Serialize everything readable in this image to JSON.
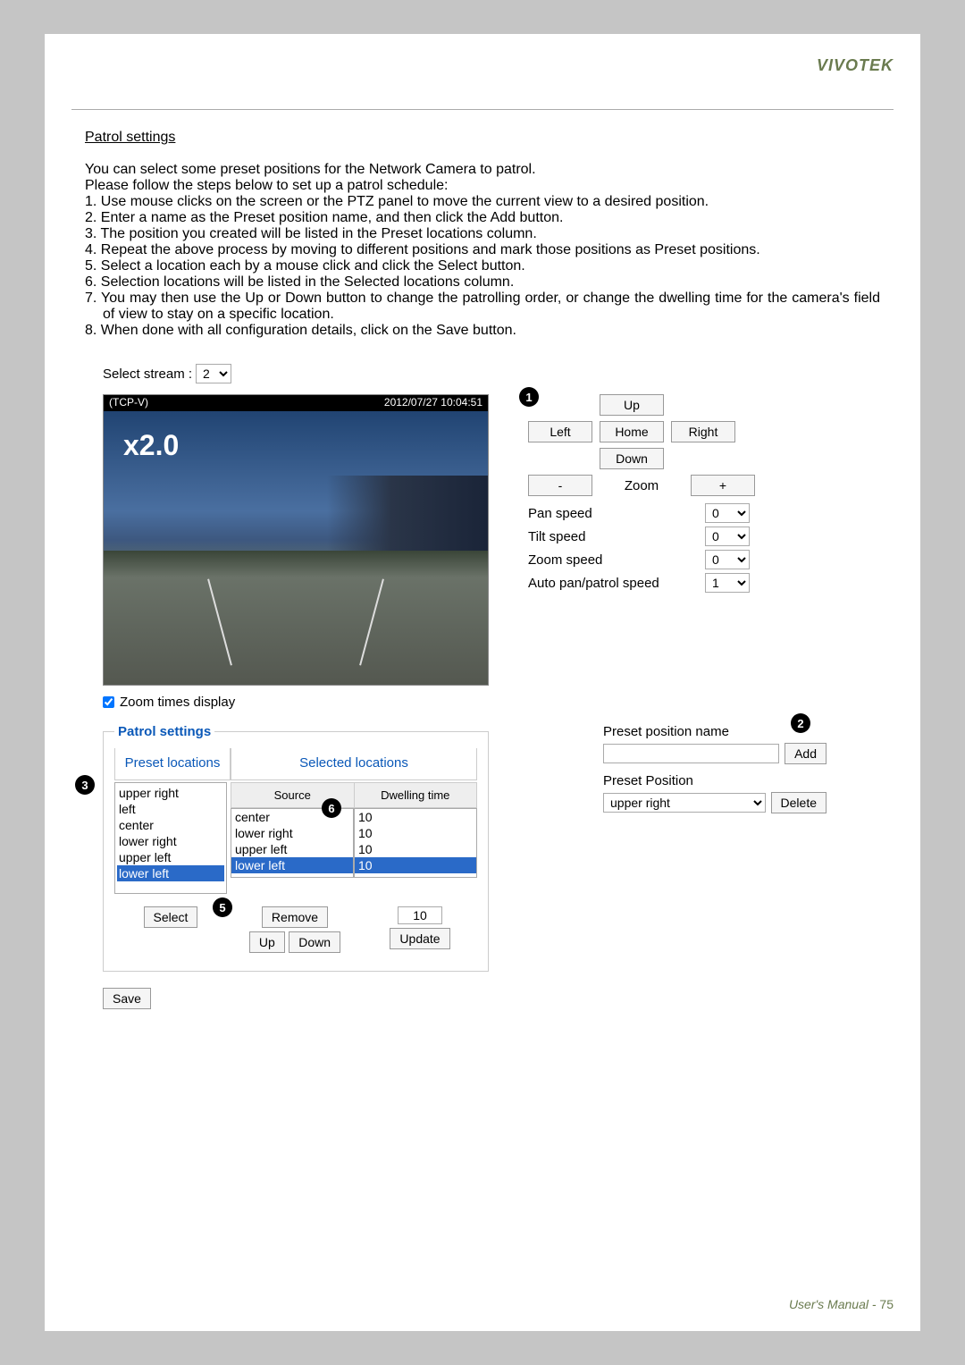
{
  "brand": "VIVOTEK",
  "section_title": "Patrol settings",
  "intro1": "You can select some preset positions for the Network Camera to patrol.",
  "intro2": "Please follow the steps below to set up a patrol schedule:",
  "steps": {
    "s1": "1. Use mouse clicks on the screen or the PTZ panel to move the current view to a desired position.",
    "s2": "2. Enter a name as the Preset position name, and then click the Add button.",
    "s3": "3. The position you created will be listed in the Preset locations column.",
    "s4": "4. Repeat the above process by moving to different positions and mark those positions as Preset positions.",
    "s5": "5. Select a location each by a mouse click and click the Select button.",
    "s6": "6. Selection locations will be listed in the Selected locations column.",
    "s7": "7. You may then use the Up or Down button to change the patrolling order, or change the dwelling time for the camera's field of view to stay on a specific location.",
    "s8": "8. When done with all configuration details, click on the Save button."
  },
  "stream": {
    "label": "Select stream :",
    "value": "2"
  },
  "video": {
    "protocol": "(TCP-V)",
    "timestamp": "2012/07/27 10:04:51",
    "zoom": "x2.0"
  },
  "ptz": {
    "up": "Up",
    "left": "Left",
    "home": "Home",
    "right": "Right",
    "down": "Down",
    "minus": "-",
    "zoom_label": "Zoom",
    "plus": "+",
    "pan_speed": "Pan speed",
    "pan_val": "0",
    "tilt_speed": "Tilt speed",
    "tilt_val": "0",
    "zoom_speed": "Zoom speed",
    "zoom_val": "0",
    "auto_speed": "Auto pan/patrol speed",
    "auto_val": "1"
  },
  "zoom_display_label": "Zoom times display",
  "patrol": {
    "legend": "Patrol settings",
    "preset_header": "Preset locations",
    "selected_header": "Selected locations",
    "source_header": "Source",
    "dwell_header": "Dwelling time",
    "preset_items": {
      "i0": "upper right",
      "i1": "left",
      "i2": "center",
      "i3": "lower right",
      "i4": "upper left",
      "i5": "lower left"
    },
    "source_items": {
      "i0": "center",
      "i1": "lower right",
      "i2": "upper left",
      "i3": "lower left"
    },
    "dwell_items": {
      "i0": "10",
      "i1": "10",
      "i2": "10",
      "i3": "10"
    },
    "select_btn": "Select",
    "remove_btn": "Remove",
    "up_btn": "Up",
    "down_btn": "Down",
    "dwell_input": "10",
    "update_btn": "Update"
  },
  "preset_form": {
    "name_label": "Preset position name",
    "add_btn": "Add",
    "pos_label": "Preset Position",
    "pos_value": "upper right",
    "delete_btn": "Delete"
  },
  "save_btn": "Save",
  "footer_label": "User's Manual - ",
  "footer_page": "75",
  "badges": {
    "b1": "1",
    "b2": "2",
    "b3": "3",
    "b5": "5",
    "b6": "6"
  }
}
